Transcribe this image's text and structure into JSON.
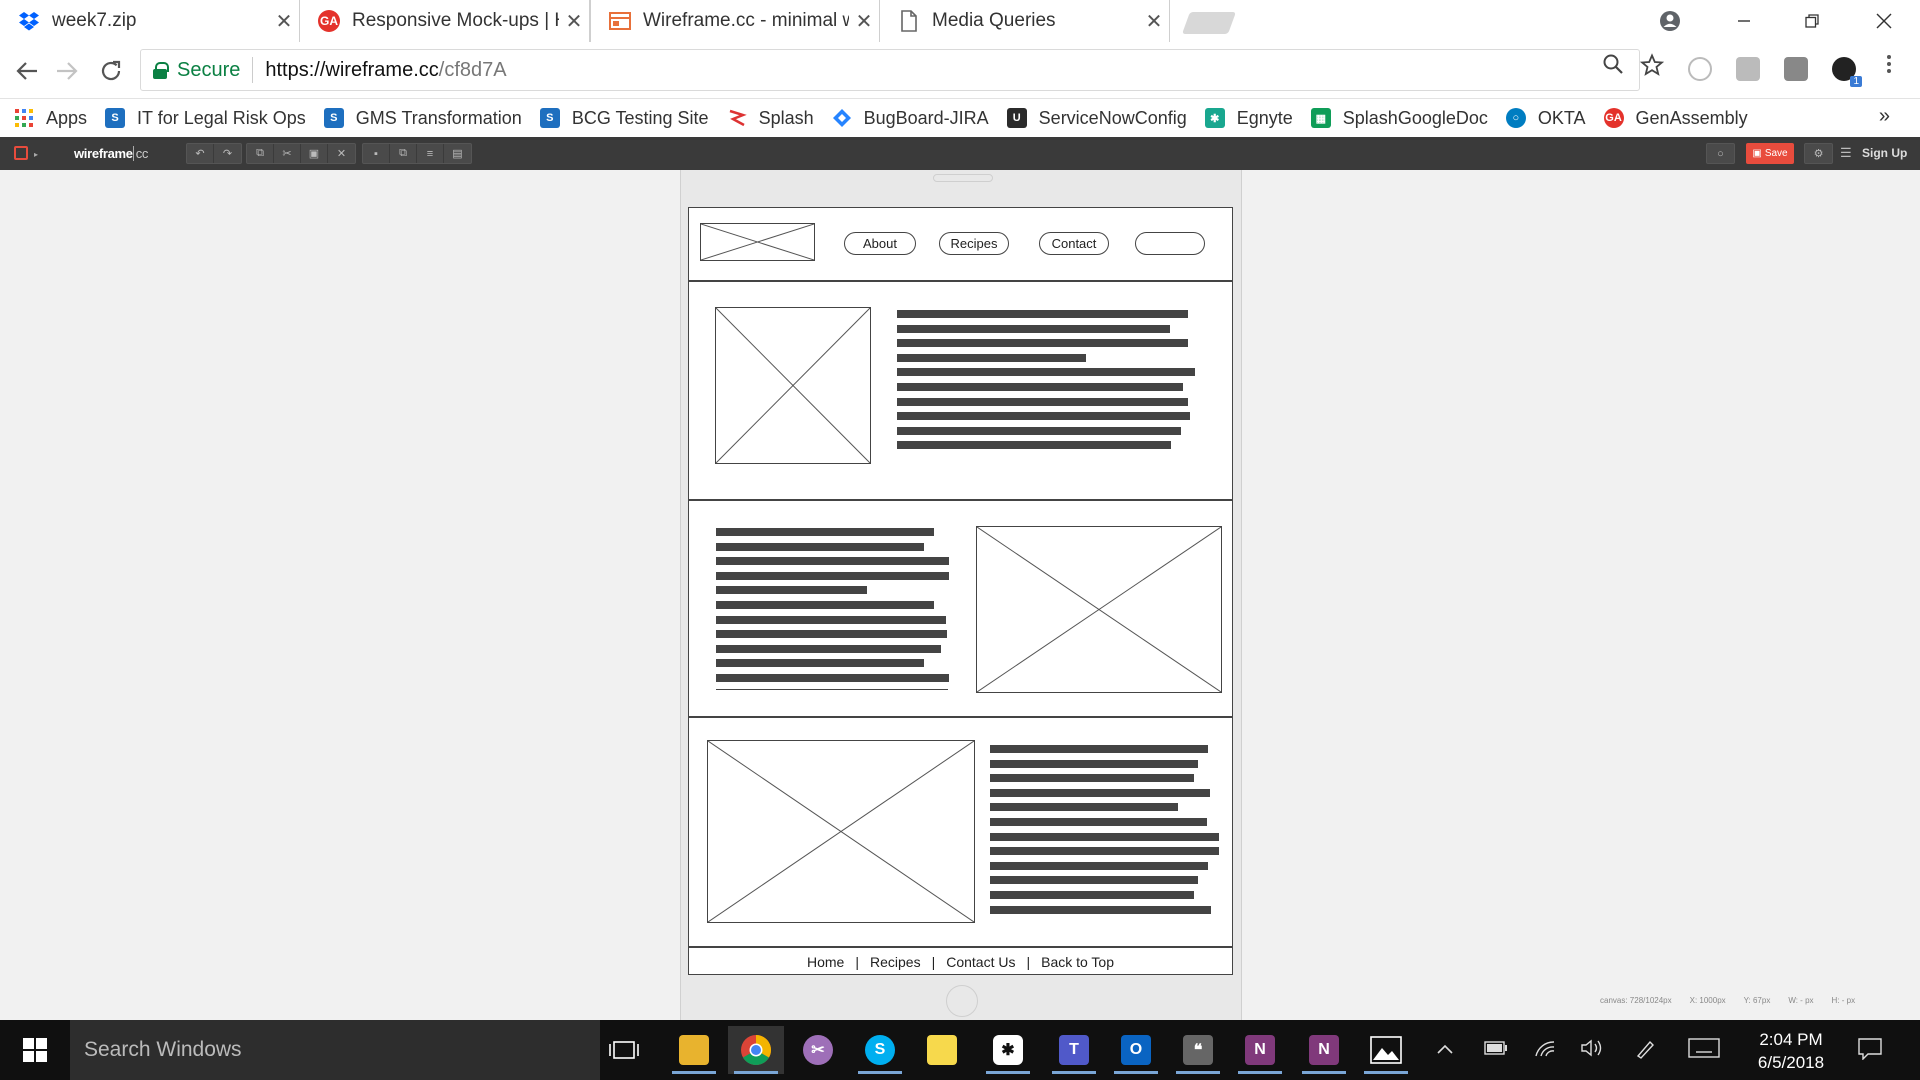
{
  "browser": {
    "tabs": [
      {
        "title": "week7.zip",
        "icon": "dropbox-icon"
      },
      {
        "title": "Responsive Mock-ups | H",
        "icon": "ga-icon"
      },
      {
        "title": "Wireframe.cc - minimal w",
        "icon": "wireframe-icon"
      },
      {
        "title": "Media Queries",
        "icon": "page-icon"
      }
    ],
    "close_glyph": "✕",
    "secure_label": "Secure",
    "url_host": "https://wireframe.cc",
    "url_path": "/cf8d7A",
    "extension_badge": "1",
    "bookmarks": [
      {
        "label": "Apps",
        "icon": "apps-grid-icon",
        "color": "#4285f4"
      },
      {
        "label": "IT for Legal Risk Ops",
        "icon": "sharepoint-icon",
        "color": "#1e6fbf"
      },
      {
        "label": "GMS Transformation",
        "icon": "sharepoint-icon",
        "color": "#1e6fbf"
      },
      {
        "label": "BCG Testing Site",
        "icon": "sharepoint-icon",
        "color": "#1e6fbf"
      },
      {
        "label": "Splash",
        "icon": "splash-icon",
        "color": "#d33"
      },
      {
        "label": "BugBoard-JIRA",
        "icon": "jira-icon",
        "color": "#2684ff"
      },
      {
        "label": "ServiceNowConfig",
        "icon": "servicenow-icon",
        "color": "#2b2b2b"
      },
      {
        "label": "Egnyte",
        "icon": "egnyte-icon",
        "color": "#19a78f"
      },
      {
        "label": "SplashGoogleDoc",
        "icon": "sheets-icon",
        "color": "#0f9d58"
      },
      {
        "label": "OKTA",
        "icon": "okta-icon",
        "color": "#007dc1"
      },
      {
        "label": "GenAssembly",
        "icon": "ga-icon",
        "color": "#e4322b"
      }
    ],
    "bookmarks_more": "»"
  },
  "app": {
    "logo_main": "wireframe",
    "logo_suffix": "cc",
    "save_label": "Save",
    "signup_label": "Sign Up"
  },
  "wireframe": {
    "nav": [
      "About",
      "Recipes",
      "Contact",
      ""
    ],
    "footer_links": [
      "Home",
      "Recipes",
      "Contact Us",
      "Back to Top"
    ],
    "footer_separator": "|"
  },
  "status": {
    "canvas": "canvas: 728/1024px",
    "x": "X: 1000px",
    "y": "Y: 67px",
    "w": "W: - px",
    "h": "H: - px"
  },
  "taskbar": {
    "search_placeholder": "Search Windows",
    "time": "2:04 PM",
    "date": "6/5/2018"
  }
}
